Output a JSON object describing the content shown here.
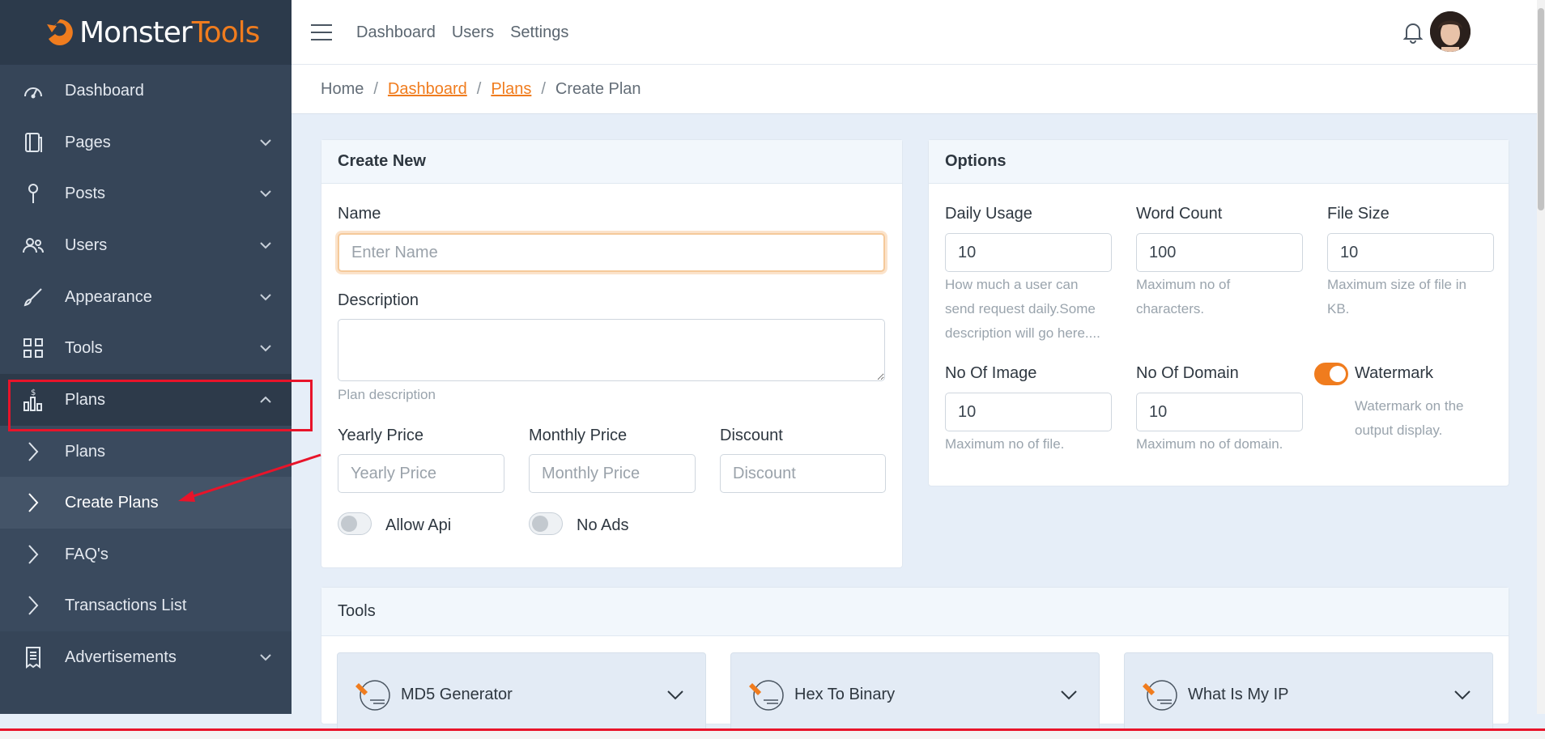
{
  "brand": {
    "part1": "Monster",
    "part2": "Tools",
    "accent": "#f07c1e"
  },
  "topbar": {
    "links": [
      "Dashboard",
      "Users",
      "Settings"
    ]
  },
  "sidebar": {
    "items": [
      {
        "label": "Dashboard",
        "icon": "gauge-icon"
      },
      {
        "label": "Pages",
        "icon": "pages-icon"
      },
      {
        "label": "Posts",
        "icon": "pin-icon"
      },
      {
        "label": "Users",
        "icon": "users-icon"
      },
      {
        "label": "Appearance",
        "icon": "brush-icon"
      },
      {
        "label": "Tools",
        "icon": "grid-icon"
      },
      {
        "label": "Plans",
        "icon": "plans-icon"
      },
      {
        "label": "Plans",
        "icon": "chevron-right-icon"
      },
      {
        "label": "Create Plans",
        "icon": "chevron-right-icon"
      },
      {
        "label": "FAQ's",
        "icon": "chevron-right-icon"
      },
      {
        "label": "Transactions List",
        "icon": "chevron-right-icon"
      },
      {
        "label": "Advertisements",
        "icon": "receipt-icon"
      }
    ]
  },
  "breadcrumb": {
    "home": "Home",
    "dashboard": "Dashboard",
    "plans": "Plans",
    "current": "Create Plan",
    "sep": "/"
  },
  "create": {
    "title": "Create New",
    "name_label": "Name",
    "name_placeholder": "Enter Name",
    "desc_label": "Description",
    "desc_help": "Plan description",
    "yearly_label": "Yearly Price",
    "yearly_placeholder": "Yearly Price",
    "monthly_label": "Monthly Price",
    "monthly_placeholder": "Monthly Price",
    "discount_label": "Discount",
    "discount_placeholder": "Discount",
    "allow_api": "Allow Api",
    "no_ads": "No Ads"
  },
  "options": {
    "title": "Options",
    "daily_label": "Daily Usage",
    "daily_value": "10",
    "daily_help1": "How much a user can",
    "daily_help2": "send request daily.Some",
    "daily_help3": "description will go here....",
    "word_label": "Word Count",
    "word_value": "100",
    "word_help1": "Maximum no of",
    "word_help2": "characters.",
    "file_label": "File Size",
    "file_value": "10",
    "file_help1": "Maximum size of file in",
    "file_help2": "KB.",
    "image_label": "No Of Image",
    "image_value": "10",
    "image_help": "Maximum no of file.",
    "domain_label": "No Of Domain",
    "domain_value": "10",
    "domain_help": "Maximum no of domain.",
    "watermark_label": "Watermark",
    "watermark_help1": "Watermark on the",
    "watermark_help2": "output display."
  },
  "tools": {
    "title": "Tools",
    "items": [
      {
        "label": "MD5 Generator"
      },
      {
        "label": "Hex To Binary"
      },
      {
        "label": "What Is My IP"
      }
    ]
  }
}
